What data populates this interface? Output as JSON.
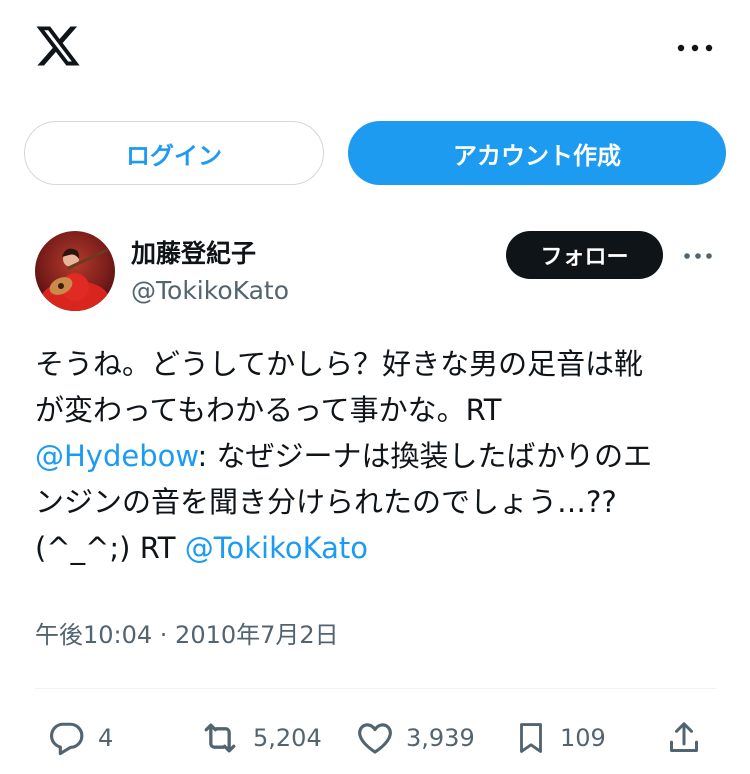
{
  "app": {
    "logo_icon": "x-logo-icon",
    "more_icon": "more-horizontal-icon"
  },
  "auth": {
    "login_label": "ログイン",
    "signup_label": "アカウント作成"
  },
  "tweet": {
    "author": {
      "display_name": "加藤登紀子",
      "handle": "@TokikoKato",
      "avatar_icon": "profile-photo"
    },
    "follow_label": "フォロー",
    "text": {
      "part1": "そうね。どうしてかしら？好きな男の足音は靴",
      "part2": "が変わってもわかるって事かな。RT",
      "mention1": "@Hydebow",
      "part3": ": なぜジーナは換装したばかりのエ",
      "part4": "ンジンの音を聞き分けられたのでしょう…??",
      "part5": "(^_^;) RT ",
      "mention2": "@TokikoKato"
    },
    "timestamp": "午後10:04 · 2010年7月2日",
    "stats": {
      "replies": "4",
      "retweets": "5,204",
      "likes": "3,939",
      "bookmarks": "109"
    }
  },
  "colors": {
    "accent": "#1d9bf0",
    "text": "#0f1419",
    "secondary": "#536471",
    "border": "#cfd9de",
    "divider": "#eff3f4"
  }
}
